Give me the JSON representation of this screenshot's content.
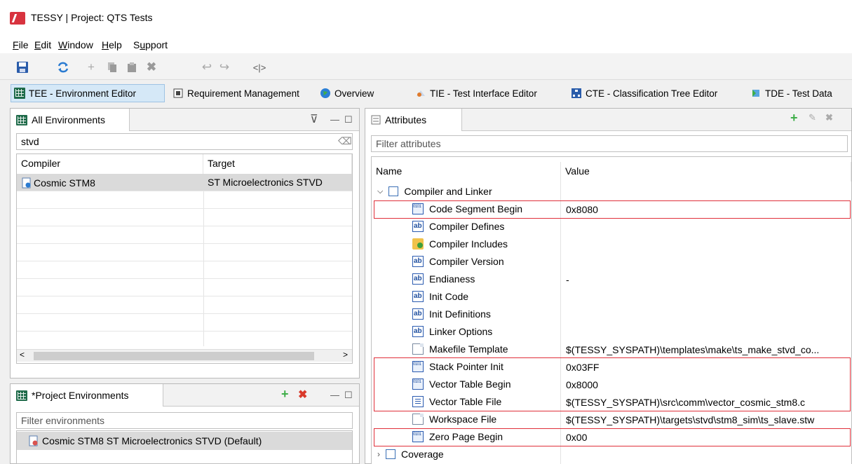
{
  "window": {
    "title": "TESSY | Project: QTS Tests"
  },
  "menu": [
    {
      "pre": "",
      "u": "F",
      "post": "ile"
    },
    {
      "pre": "",
      "u": "E",
      "post": "dit"
    },
    {
      "pre": "",
      "u": "W",
      "post": "indow"
    },
    {
      "pre": "",
      "u": "H",
      "post": "elp"
    },
    {
      "pre": "S",
      "u": "u",
      "post": "pport"
    }
  ],
  "toolbar_icons": [
    "save-icon",
    "refresh-icon",
    "add-icon",
    "copy-icon",
    "paste-icon",
    "delete-icon",
    "undo-icon",
    "redo-icon",
    "compare-icon"
  ],
  "perspectives": [
    {
      "label": "TEE - Environment Editor",
      "icon": "grid-icon",
      "active": true
    },
    {
      "label": "Requirement Management",
      "icon": "document-icon"
    },
    {
      "label": "Overview",
      "icon": "globe-icon"
    },
    {
      "label": "TIE - Test Interface Editor",
      "icon": "interface-icon"
    },
    {
      "label": "CTE - Classification Tree Editor",
      "icon": "tree-icon"
    },
    {
      "label": "TDE - Test Data",
      "icon": "data-icon"
    }
  ],
  "all_envs": {
    "tab": "All Environments",
    "filter_value": "stvd",
    "columns": [
      "Compiler",
      "Target"
    ],
    "rows": [
      {
        "compiler": "Cosmic STM8",
        "target": "ST Microelectronics STVD"
      }
    ]
  },
  "project_envs": {
    "tab": "*Project Environments",
    "filter_placeholder": "Filter environments",
    "items": [
      "Cosmic STM8 ST Microelectronics STVD (Default)"
    ]
  },
  "attributes": {
    "tab": "Attributes",
    "filter_placeholder": "Filter attributes",
    "columns": [
      "Name",
      "Value"
    ],
    "group": "Compiler and Linker",
    "rows": [
      {
        "name": "Code Segment Begin",
        "value": "0x8080",
        "icon": "binary-icon"
      },
      {
        "name": "Compiler Defines",
        "value": "",
        "icon": "text-icon"
      },
      {
        "name": "Compiler Includes",
        "value": "",
        "icon": "folder-icon"
      },
      {
        "name": "Compiler Version",
        "value": "",
        "icon": "text-icon"
      },
      {
        "name": "Endianess",
        "value": "-",
        "icon": "text-icon"
      },
      {
        "name": "Init Code",
        "value": "",
        "icon": "text-icon"
      },
      {
        "name": "Init Definitions",
        "value": "",
        "icon": "text-icon"
      },
      {
        "name": "Linker Options",
        "value": "",
        "icon": "text-icon"
      },
      {
        "name": "Makefile Template",
        "value": "$(TESSY_SYSPATH)\\templates\\make\\ts_make_stvd_co...",
        "icon": "file-icon"
      },
      {
        "name": "Stack Pointer Init",
        "value": "0x03FF",
        "icon": "binary-icon"
      },
      {
        "name": "Vector Table Begin",
        "value": "0x8000",
        "icon": "binary-icon"
      },
      {
        "name": "Vector Table File",
        "value": "$(TESSY_SYSPATH)\\src\\comm\\vector_cosmic_stm8.c",
        "icon": "file-icon"
      },
      {
        "name": "Workspace File",
        "value": "$(TESSY_SYSPATH)\\targets\\stvd\\stm8_sim\\ts_slave.stw",
        "icon": "file-icon"
      },
      {
        "name": "Zero Page Begin",
        "value": "0x00",
        "icon": "binary-icon"
      }
    ],
    "group2": "Coverage"
  },
  "colors": {
    "highlight": "#e0303a",
    "active_perspective": "#d5e8f7",
    "selection": "#dadada"
  }
}
